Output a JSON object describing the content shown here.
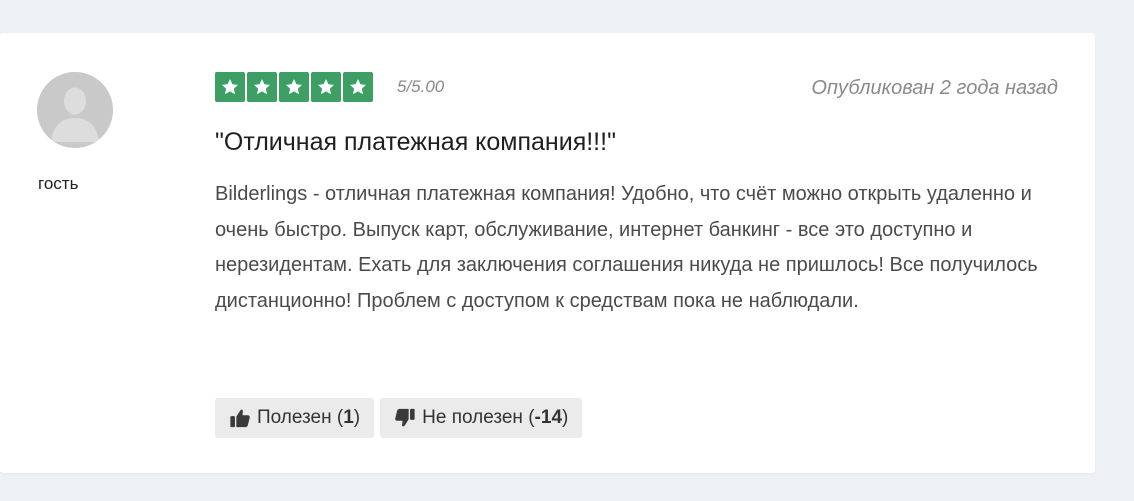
{
  "review": {
    "author": "гость",
    "rating": {
      "stars": 5,
      "max_stars": 5,
      "score_text": "5/5.00",
      "color": "#3d9f63"
    },
    "published": "Опубликован 2 года назад",
    "title": "\"Отличная платежная компания!!!\"",
    "text": "Bilderlings - отличная платежная компания! Удобно, что счёт можно открыть удаленно и очень быстро. Выпуск карт, обслуживание, интернет банкинг - все это доступно и нерезидентам. Ехать для заключения соглашения никуда не пришлось! Все получилось дистанционно! Проблем с доступом к средствам пока не наблюдали.",
    "helpful": {
      "label": "Полезен",
      "count": "1",
      "icon": "thumbs-up-icon"
    },
    "not_helpful": {
      "label": "Не полезен",
      "count": "-14",
      "icon": "thumbs-down-icon"
    }
  },
  "colors": {
    "page_bg": "#edf1f5",
    "card_bg": "#ffffff",
    "star_bg": "#3d9f63",
    "avatar_bg": "#c9c9c9"
  }
}
